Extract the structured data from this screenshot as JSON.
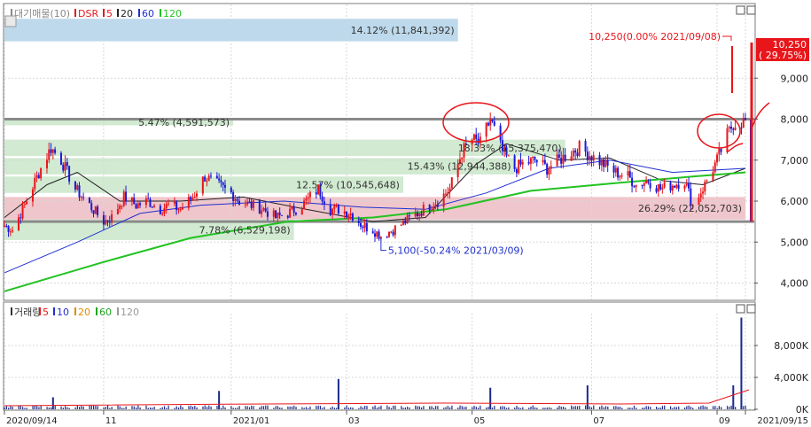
{
  "colors": {
    "up": "#e8161b",
    "down": "#1a1ad8",
    "ma5": "#e8161b",
    "ma20": "#222222",
    "ma60": "#2030d0",
    "ma120": "#22c322",
    "zone_green": "#cfe9cf",
    "zone_red": "#eec3c8",
    "zone_blue": "#b9d7ea",
    "annotation_red": "#e8161b",
    "grid": "#d8d8d8",
    "frame": "#7b7b7b",
    "ref_line": "#8a8a8a"
  },
  "upper_legend": {
    "items": [
      {
        "text": "대기매물(10)",
        "color": "#888888"
      },
      {
        "text": "DSR",
        "color": "#e8161b"
      },
      {
        "text": "5",
        "color": "#e8161b"
      },
      {
        "text": "20",
        "color": "#222222"
      },
      {
        "text": "60",
        "color": "#2030d0"
      },
      {
        "text": "120",
        "color": "#22c322"
      }
    ]
  },
  "lower_legend": {
    "items": [
      {
        "text": "거래량",
        "color": "#333333"
      },
      {
        "text": "5",
        "color": "#e8161b"
      },
      {
        "text": "10",
        "color": "#2030d0"
      },
      {
        "text": "20",
        "color": "#e08a00"
      },
      {
        "text": "60",
        "color": "#22a322"
      },
      {
        "text": "120",
        "color": "#999999"
      }
    ]
  },
  "chart_data": [
    {
      "type": "candlestick",
      "price_ylim": [
        3600,
        10800
      ],
      "y_ticks": [
        {
          "value": 4000,
          "label": "4,000"
        },
        {
          "value": 5000,
          "label": "5,000"
        },
        {
          "value": 6000,
          "label": "6,000"
        },
        {
          "value": 7000,
          "label": "7,000"
        },
        {
          "value": 8000,
          "label": "8,000"
        },
        {
          "value": 9000,
          "label": "9,000"
        }
      ],
      "x_labels": [
        {
          "date": "2020-09-14",
          "text": "2020/09/14"
        },
        {
          "date": "2020-11-02",
          "text": "11"
        },
        {
          "date": "2021-01-04",
          "text": "2021/01"
        },
        {
          "date": "2021-03-02",
          "text": "03"
        },
        {
          "date": "2021-05-03",
          "text": "05"
        },
        {
          "date": "2021-07-01",
          "text": "07"
        },
        {
          "date": "2021-09-01",
          "text": "09"
        },
        {
          "date": "2021-09-15",
          "text": "2021/09/15"
        }
      ],
      "date_range": [
        "2020-09-14",
        "2021-09-15"
      ],
      "price_points": [
        [
          "2020-09-14",
          5400
        ],
        [
          "2020-09-18",
          5300
        ],
        [
          "2020-09-24",
          5900
        ],
        [
          "2020-10-01",
          6700
        ],
        [
          "2020-10-07",
          7300
        ],
        [
          "2020-10-12",
          7000
        ],
        [
          "2020-10-19",
          6300
        ],
        [
          "2020-10-26",
          5900
        ],
        [
          "2020-11-02",
          5500
        ],
        [
          "2020-11-06",
          5600
        ],
        [
          "2020-11-12",
          6100
        ],
        [
          "2020-11-18",
          5900
        ],
        [
          "2020-11-24",
          6000
        ],
        [
          "2020-11-30",
          5800
        ],
        [
          "2020-12-04",
          5900
        ],
        [
          "2020-12-10",
          5800
        ],
        [
          "2020-12-16",
          6100
        ],
        [
          "2020-12-22",
          6600
        ],
        [
          "2020-12-28",
          6400
        ],
        [
          "2021-01-04",
          6200
        ],
        [
          "2021-01-08",
          6000
        ],
        [
          "2021-01-14",
          5900
        ],
        [
          "2021-01-20",
          5800
        ],
        [
          "2021-01-26",
          5600
        ],
        [
          "2021-02-01",
          5700
        ],
        [
          "2021-02-08",
          5900
        ],
        [
          "2021-02-16",
          6300
        ],
        [
          "2021-02-22",
          5800
        ],
        [
          "2021-02-26",
          5800
        ],
        [
          "2021-03-04",
          5700
        ],
        [
          "2021-03-10",
          5400
        ],
        [
          "2021-03-15",
          5300
        ],
        [
          "2021-03-19",
          5150
        ],
        [
          "2021-03-25",
          5300
        ],
        [
          "2021-03-31",
          5500
        ],
        [
          "2021-04-06",
          5700
        ],
        [
          "2021-04-12",
          5900
        ],
        [
          "2021-04-16",
          6000
        ],
        [
          "2021-04-22",
          6300
        ],
        [
          "2021-04-28",
          7200
        ],
        [
          "2021-05-03",
          7500
        ],
        [
          "2021-05-07",
          7400
        ],
        [
          "2021-05-12",
          8000
        ],
        [
          "2021-05-18",
          7200
        ],
        [
          "2021-05-24",
          6800
        ],
        [
          "2021-05-28",
          6900
        ],
        [
          "2021-06-03",
          7000
        ],
        [
          "2021-06-09",
          6800
        ],
        [
          "2021-06-15",
          7000
        ],
        [
          "2021-06-21",
          7200
        ],
        [
          "2021-06-25",
          7300
        ],
        [
          "2021-07-01",
          7100
        ],
        [
          "2021-07-07",
          6900
        ],
        [
          "2021-07-13",
          6700
        ],
        [
          "2021-07-19",
          6600
        ],
        [
          "2021-07-23",
          6400
        ],
        [
          "2021-07-29",
          6500
        ],
        [
          "2021-08-04",
          6300
        ],
        [
          "2021-08-10",
          6400
        ],
        [
          "2021-08-16",
          6500
        ],
        [
          "2021-08-20",
          5900
        ],
        [
          "2021-08-26",
          6400
        ],
        [
          "2021-09-01",
          7000
        ],
        [
          "2021-09-06",
          7600
        ],
        [
          "2021-09-09",
          7900
        ],
        [
          "2021-09-15",
          7950
        ]
      ],
      "ma_points": {
        "ma20": [
          [
            "2020-09-14",
            5600
          ],
          [
            "2020-10-05",
            6400
          ],
          [
            "2020-10-20",
            6700
          ],
          [
            "2020-11-10",
            6000
          ],
          [
            "2020-12-10",
            6000
          ],
          [
            "2021-01-10",
            6100
          ],
          [
            "2021-02-10",
            5800
          ],
          [
            "2021-03-15",
            5500
          ],
          [
            "2021-04-10",
            5600
          ],
          [
            "2021-05-05",
            6900
          ],
          [
            "2021-05-20",
            7400
          ],
          [
            "2021-06-15",
            7000
          ],
          [
            "2021-07-10",
            7050
          ],
          [
            "2021-08-05",
            6500
          ],
          [
            "2021-08-25",
            6400
          ],
          [
            "2021-09-15",
            6800
          ]
        ],
        "ma60": [
          [
            "2020-09-14",
            4250
          ],
          [
            "2020-10-20",
            5000
          ],
          [
            "2020-11-20",
            5700
          ],
          [
            "2020-12-20",
            5900
          ],
          [
            "2021-01-30",
            6000
          ],
          [
            "2021-03-10",
            5850
          ],
          [
            "2021-04-10",
            5800
          ],
          [
            "2021-05-10",
            6200
          ],
          [
            "2021-06-10",
            6800
          ],
          [
            "2021-07-10",
            7000
          ],
          [
            "2021-08-10",
            6700
          ],
          [
            "2021-09-15",
            6800
          ]
        ],
        "ma120": [
          [
            "2020-09-14",
            3800
          ],
          [
            "2020-11-01",
            4500
          ],
          [
            "2020-12-15",
            5100
          ],
          [
            "2021-02-01",
            5500
          ],
          [
            "2021-03-15",
            5600
          ],
          [
            "2021-04-20",
            5800
          ],
          [
            "2021-06-01",
            6250
          ],
          [
            "2021-07-15",
            6450
          ],
          [
            "2021-08-20",
            6600
          ],
          [
            "2021-09-15",
            6700
          ]
        ]
      },
      "volume_profile_zones": [
        {
          "label": "14.12% (11,841,392)",
          "low": 9900,
          "high": 10450,
          "end_date": "2021-04-26",
          "color": "#b9d7ea"
        },
        {
          "label": "5.47% (4,591,573)",
          "low": 7850,
          "high": 8000,
          "end_date": "2021-01-05",
          "color": "#cfe9cf"
        },
        {
          "label": "18.33% (15,375,470)",
          "low": 7100,
          "high": 7500,
          "end_date": "2021-06-18",
          "color": "#cfe9cf"
        },
        {
          "label": "15.43% (12,944,388)",
          "low": 6650,
          "high": 7050,
          "end_date": "2021-05-24",
          "color": "#cfe9cf"
        },
        {
          "label": "12.57% (10,545,648)",
          "low": 6200,
          "high": 6600,
          "end_date": "2021-03-30",
          "color": "#cfe9cf"
        },
        {
          "label": "26.29% (22,052,703)",
          "low": 5550,
          "high": 6100,
          "end_date": "2021-09-15",
          "color": "#eec3c8"
        },
        {
          "label": "7.78% (6,529,198)",
          "low": 5050,
          "high": 5550,
          "end_date": "2021-02-04",
          "color": "#cfe9cf"
        }
      ],
      "reference_lines": [
        8000,
        5500
      ],
      "low_annotation": {
        "date": "2021-03-19",
        "value": 5100,
        "text": "5,100(-50.24% 2021/03/09)"
      },
      "high_annotation": {
        "date": "2021-09-08",
        "value": 10250,
        "text": "10,250(0.00% 2021/09/08)"
      },
      "price_tag": {
        "value": 10250,
        "line1": "10,250",
        "line2": "( 29.75%)"
      }
    },
    {
      "type": "bar",
      "volume_ylim": [
        0,
        12000
      ],
      "y_ticks": [
        {
          "value": 0,
          "label": "0K"
        },
        {
          "value": 4000,
          "label": "4,000K"
        },
        {
          "value": 8000,
          "label": "8,000K"
        }
      ],
      "volume_spikes": [
        [
          "2020-10-08",
          1500
        ],
        [
          "2020-12-29",
          2300
        ],
        [
          "2021-02-26",
          3800
        ],
        [
          "2021-05-12",
          2700
        ],
        [
          "2021-06-29",
          3000
        ],
        [
          "2021-09-09",
          3000
        ],
        [
          "2021-09-13",
          11500
        ]
      ]
    }
  ]
}
